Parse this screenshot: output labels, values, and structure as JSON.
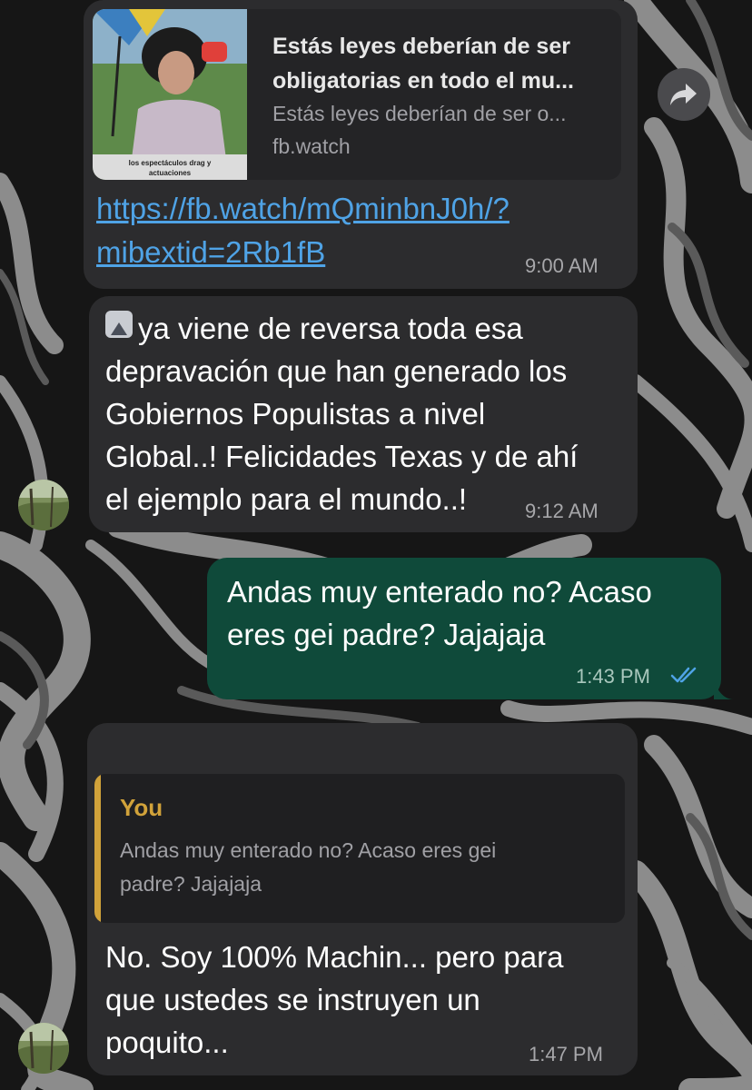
{
  "messages": [
    {
      "link_preview": {
        "title": "Estás leyes deberían de ser obligatorias en todo el mu...",
        "description": "Estás leyes deberían de ser o...",
        "domain": "fb.watch",
        "thumbnail_caption": "los espectáculos drag y actuaciones"
      },
      "link_text_line1": "https://fb.watch/mQminbnJ0h/?",
      "link_text_line2": "mibextid=2Rb1fB",
      "time": "9:00 AM"
    },
    {
      "emoji": "up-arrow-button",
      "text_lines": [
        "ya viene de reversa toda esa",
        "depravación que han generado los",
        "Gobiernos Populistas a nivel",
        "Global..! Felicidades Texas y de ahí",
        "el ejemplo para el mundo..!"
      ],
      "time": "9:12 AM"
    },
    {
      "text_lines": [
        "Andas muy enterado no? Acaso",
        "eres gei padre? Jajajaja"
      ],
      "time": "1:43 PM",
      "status": "read-double-check"
    },
    {
      "reply": {
        "name": "You",
        "text_lines": [
          "Andas muy enterado no? Acaso eres gei",
          "padre? Jajajaja"
        ]
      },
      "text_lines": [
        "No. Soy 100% Machin... pero para",
        "que ustedes se instruyen un",
        "poquito..."
      ],
      "time": "1:47 PM"
    }
  ],
  "colors": {
    "incoming_bubble": "#2c2c2e",
    "outgoing_bubble": "#0f4a3a",
    "link": "#4fa3e6",
    "reply_accent": "#d1a23a",
    "read_ticks": "#4fa3e6"
  },
  "icons": [
    "forward-icon",
    "avatar-icon",
    "double-check-icon",
    "up-arrow-emoji-icon"
  ]
}
